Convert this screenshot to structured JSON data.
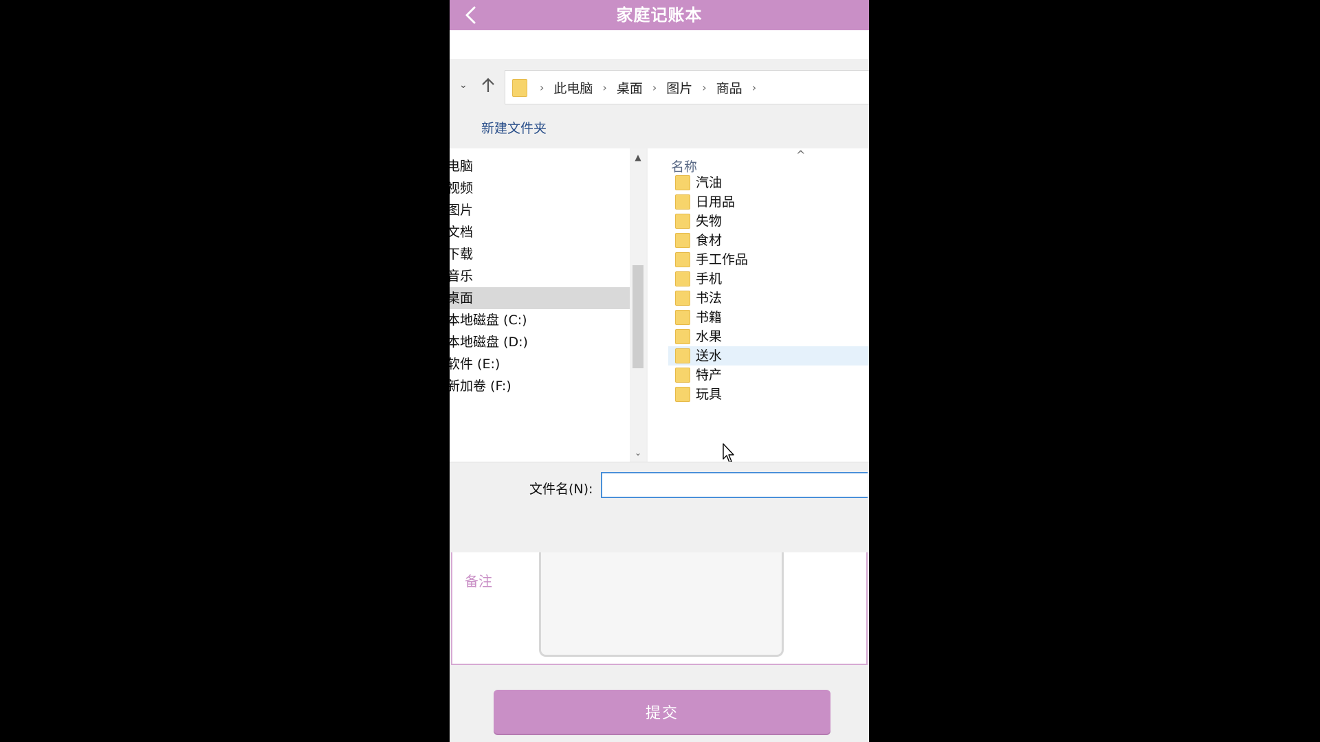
{
  "app": {
    "title": "家庭记账本",
    "accent": "#c98fc6"
  },
  "dialog": {
    "breadcrumbs": [
      "此电脑",
      "桌面",
      "图片",
      "商品"
    ],
    "new_folder": "新建文件夹",
    "nav_items": [
      {
        "label": "电脑"
      },
      {
        "label": "视频"
      },
      {
        "label": "图片"
      },
      {
        "label": "文档"
      },
      {
        "label": "下载"
      },
      {
        "label": "音乐"
      },
      {
        "label": "桌面",
        "selected": true
      },
      {
        "label": "本地磁盘 (C:)"
      },
      {
        "label": "本地磁盘 (D:)"
      },
      {
        "label": "软件 (E:)"
      },
      {
        "label": "新加卷 (F:)"
      }
    ],
    "column_name": "名称",
    "folders": [
      "汽油",
      "日用品",
      "失物",
      "食材",
      "手工作品",
      "手机",
      "书法",
      "书籍",
      "水果",
      "送水",
      "特产",
      "玩具"
    ],
    "hovered_folder": "送水",
    "filename_label": "文件名(N):",
    "filename_value": ""
  },
  "form": {
    "remark_label": "备注",
    "submit_label": "提交"
  },
  "icons": {
    "back": "chevron-left-icon",
    "up": "arrow-up-icon",
    "folder": "folder-icon"
  }
}
